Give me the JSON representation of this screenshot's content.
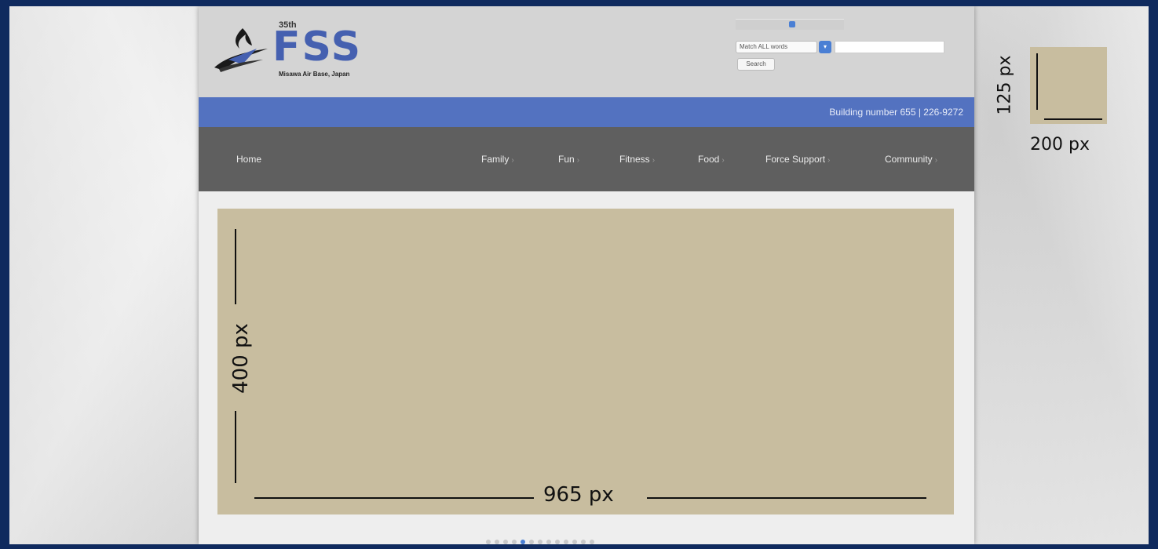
{
  "header": {
    "logo": {
      "number": "35th",
      "name": "FSS",
      "subtitle": "Misawa Air Base, Japan"
    },
    "search": {
      "match_option": "Match ALL words",
      "button_label": "Search",
      "input_value": "",
      "select_icon": "chevron-down-icon"
    }
  },
  "info_bar": {
    "text": "Building number 655 | 226-9272"
  },
  "nav": {
    "items": [
      {
        "label": "Home",
        "has_dropdown": false
      },
      {
        "label": "Family",
        "has_dropdown": true
      },
      {
        "label": "Fun",
        "has_dropdown": true
      },
      {
        "label": "Fitness",
        "has_dropdown": true
      },
      {
        "label": "Food",
        "has_dropdown": true
      },
      {
        "label": "Force Support",
        "has_dropdown": true
      },
      {
        "label": "Community",
        "has_dropdown": true
      }
    ],
    "dropdown_marker": "›"
  },
  "slider": {
    "dot_count": 13,
    "active_index": 4,
    "width_annotation": "965 px",
    "height_annotation": "400 px"
  },
  "mini_box": {
    "width_annotation": "200 px",
    "height_annotation": "125 px"
  },
  "colors": {
    "outer_border": "#0f2a5e",
    "info_bar": "#5372c0",
    "nav": "#5f5f5f",
    "placeholder": "#c8bd9f",
    "logo_blue": "#4560b0"
  }
}
